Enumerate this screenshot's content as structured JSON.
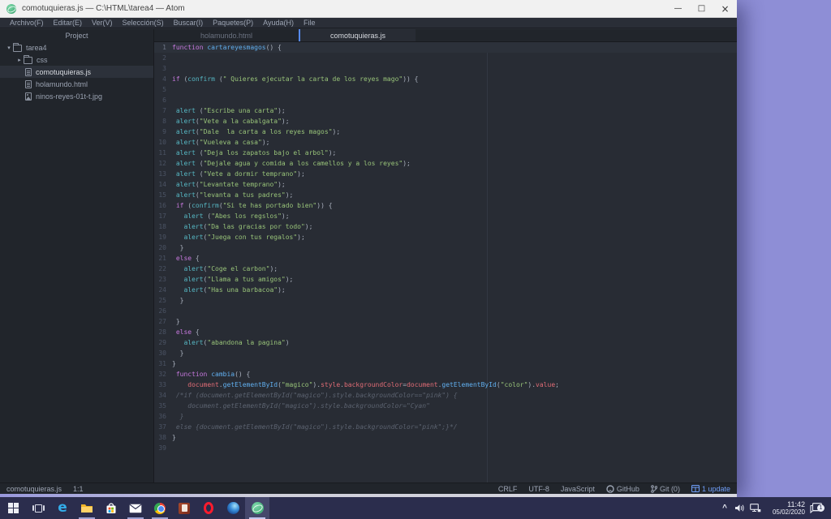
{
  "desktop": {
    "wallpaper_color": "#8e8ed6"
  },
  "window": {
    "title": "comotuquieras.js — C:\\HTML\\tarea4 — Atom",
    "controls": {
      "minimize": "—",
      "maximize": "□",
      "close": "×"
    }
  },
  "menu": {
    "items": [
      "Archivo(F)",
      "Editar(E)",
      "Ver(V)",
      "Selección(S)",
      "Buscar(I)",
      "Paquetes(P)",
      "Ayuda(H)",
      "File"
    ]
  },
  "project": {
    "header": "Project",
    "tree": [
      {
        "label": "tarea4",
        "type": "folder",
        "expanded": true,
        "depth": 0,
        "selected": false
      },
      {
        "label": "css",
        "type": "folder",
        "expanded": false,
        "depth": 1,
        "selected": false
      },
      {
        "label": "comotuquieras.js",
        "type": "file",
        "depth": 1,
        "selected": true
      },
      {
        "label": "holamundo.html",
        "type": "file",
        "depth": 1,
        "selected": false
      },
      {
        "label": "ninos-reyes-01t-t.jpg",
        "type": "image",
        "depth": 1,
        "selected": false
      }
    ]
  },
  "tabs": [
    {
      "label": "holamundo.html",
      "active": false
    },
    {
      "label": "comotuquieras.js",
      "active": true
    }
  ],
  "editor": {
    "active_line": 1,
    "lines": [
      [
        [
          "kw",
          "function"
        ],
        [
          "pl",
          " "
        ],
        [
          "fn",
          "cartareyesmagos"
        ],
        [
          "pl",
          "() {"
        ]
      ],
      [],
      [],
      [
        [
          "kw",
          "if"
        ],
        [
          "pl",
          " ("
        ],
        [
          "sup",
          "confirm"
        ],
        [
          "pl",
          " ("
        ],
        [
          "str",
          "\" Quieres ejecutar la carta de los reyes mago\""
        ],
        [
          "pl",
          ")) {"
        ]
      ],
      [],
      [],
      [
        [
          "pl",
          " "
        ],
        [
          "sup",
          "alert"
        ],
        [
          "pl",
          " ("
        ],
        [
          "str",
          "\"Escribe una carta\""
        ],
        [
          "pl",
          ");"
        ]
      ],
      [
        [
          "pl",
          " "
        ],
        [
          "sup",
          "alert"
        ],
        [
          "pl",
          "("
        ],
        [
          "str",
          "\"Vete a la cabalgata\""
        ],
        [
          "pl",
          ");"
        ]
      ],
      [
        [
          "pl",
          " "
        ],
        [
          "sup",
          "alert"
        ],
        [
          "pl",
          "("
        ],
        [
          "str",
          "\"Dale  la carta a los reyes magos\""
        ],
        [
          "pl",
          ");"
        ]
      ],
      [
        [
          "pl",
          " "
        ],
        [
          "sup",
          "alert"
        ],
        [
          "pl",
          "("
        ],
        [
          "str",
          "\"Vueleva a casa\""
        ],
        [
          "pl",
          ");"
        ]
      ],
      [
        [
          "pl",
          " "
        ],
        [
          "sup",
          "alert"
        ],
        [
          "pl",
          " ("
        ],
        [
          "str",
          "\"Deja los zapatos bajo el arbol\""
        ],
        [
          "pl",
          ");"
        ]
      ],
      [
        [
          "pl",
          " "
        ],
        [
          "sup",
          "alert"
        ],
        [
          "pl",
          " ("
        ],
        [
          "str",
          "\"Dejale agua y comida a los camellos y a los reyes\""
        ],
        [
          "pl",
          ");"
        ]
      ],
      [
        [
          "pl",
          " "
        ],
        [
          "sup",
          "alert"
        ],
        [
          "pl",
          " ("
        ],
        [
          "str",
          "\"Vete a dormir temprano\""
        ],
        [
          "pl",
          ");"
        ]
      ],
      [
        [
          "pl",
          " "
        ],
        [
          "sup",
          "alert"
        ],
        [
          "pl",
          "("
        ],
        [
          "str",
          "\"Levantate temprano\""
        ],
        [
          "pl",
          ");"
        ]
      ],
      [
        [
          "pl",
          " "
        ],
        [
          "sup",
          "alert"
        ],
        [
          "pl",
          "("
        ],
        [
          "str",
          "\"levanta a tus padres\""
        ],
        [
          "pl",
          ");"
        ]
      ],
      [
        [
          "pl",
          " "
        ],
        [
          "kw",
          "if"
        ],
        [
          "pl",
          " ("
        ],
        [
          "sup",
          "confirm"
        ],
        [
          "pl",
          "("
        ],
        [
          "str",
          "\"Si te has portado bien\""
        ],
        [
          "pl",
          ")) {"
        ]
      ],
      [
        [
          "pl",
          "   "
        ],
        [
          "sup",
          "alert"
        ],
        [
          "pl",
          " ("
        ],
        [
          "str",
          "\"Abes los regslos\""
        ],
        [
          "pl",
          ");"
        ]
      ],
      [
        [
          "pl",
          "   "
        ],
        [
          "sup",
          "alert"
        ],
        [
          "pl",
          "("
        ],
        [
          "str",
          "\"Da las gracias por todo\""
        ],
        [
          "pl",
          ");"
        ]
      ],
      [
        [
          "pl",
          "   "
        ],
        [
          "sup",
          "alert"
        ],
        [
          "pl",
          "("
        ],
        [
          "str",
          "\"Juega con tus regalos\""
        ],
        [
          "pl",
          ");"
        ]
      ],
      [
        [
          "pl",
          "  }"
        ]
      ],
      [
        [
          "pl",
          " "
        ],
        [
          "kw",
          "else"
        ],
        [
          "pl",
          " {"
        ]
      ],
      [
        [
          "pl",
          "   "
        ],
        [
          "sup",
          "alert"
        ],
        [
          "pl",
          "("
        ],
        [
          "str",
          "\"Coge el carbon\""
        ],
        [
          "pl",
          ");"
        ]
      ],
      [
        [
          "pl",
          "   "
        ],
        [
          "sup",
          "alert"
        ],
        [
          "pl",
          "("
        ],
        [
          "str",
          "\"Llama a tus amigos\""
        ],
        [
          "pl",
          ");"
        ]
      ],
      [
        [
          "pl",
          "   "
        ],
        [
          "sup",
          "alert"
        ],
        [
          "pl",
          "("
        ],
        [
          "str",
          "\"Has una barbacoa\""
        ],
        [
          "pl",
          ");"
        ]
      ],
      [
        [
          "pl",
          "  }"
        ]
      ],
      [],
      [
        [
          "pl",
          " }"
        ]
      ],
      [
        [
          "pl",
          " "
        ],
        [
          "kw",
          "else"
        ],
        [
          "pl",
          " {"
        ]
      ],
      [
        [
          "pl",
          "   "
        ],
        [
          "sup",
          "alert"
        ],
        [
          "pl",
          "("
        ],
        [
          "str",
          "\"abandona la pagina\""
        ],
        [
          "pl",
          ")"
        ]
      ],
      [
        [
          "pl",
          "  }"
        ]
      ],
      [
        [
          "pl",
          "}"
        ]
      ],
      [
        [
          "pl",
          " "
        ],
        [
          "kw",
          "function"
        ],
        [
          "pl",
          " "
        ],
        [
          "fn",
          "cambia"
        ],
        [
          "pl",
          "() {"
        ]
      ],
      [
        [
          "pl",
          "    "
        ],
        [
          "prop",
          "document"
        ],
        [
          "pl",
          "."
        ],
        [
          "fn",
          "getElementById"
        ],
        [
          "pl",
          "("
        ],
        [
          "str",
          "\"magico\""
        ],
        [
          "pl",
          ")."
        ],
        [
          "prop",
          "style"
        ],
        [
          "pl",
          "."
        ],
        [
          "prop",
          "backgroundColor"
        ],
        [
          "pl",
          "="
        ],
        [
          "prop",
          "document"
        ],
        [
          "pl",
          "."
        ],
        [
          "fn",
          "getElementById"
        ],
        [
          "pl",
          "("
        ],
        [
          "str",
          "\"color\""
        ],
        [
          "pl",
          ")."
        ],
        [
          "prop",
          "value"
        ],
        [
          "pl",
          ";"
        ]
      ],
      [
        [
          "pl",
          " "
        ],
        [
          "cmt",
          "/*if (document.getElementById(\"magico\").style.backgroundColor==\"pink\") {"
        ]
      ],
      [
        [
          "cmt",
          "    document.getElementById(\"magico\").style.backgroundColor=\"Cyan\""
        ]
      ],
      [
        [
          "cmt",
          "  }"
        ]
      ],
      [
        [
          "pl",
          " "
        ],
        [
          "cmt",
          "else {document.getElementById(\"magico\").style.backgroundColor=\"pink\";}*/"
        ]
      ],
      [
        [
          "pl",
          "}"
        ]
      ],
      []
    ]
  },
  "status": {
    "file": "comotuquieras.js",
    "position": "1:1",
    "line_ending": "CRLF",
    "encoding": "UTF-8",
    "grammar": "JavaScript",
    "github": "GitHub",
    "git": "Git (0)",
    "updates": "1 update"
  },
  "taskbar": {
    "apps": [
      "start",
      "task-view",
      "edge",
      "file-explorer",
      "store",
      "mail",
      "chrome",
      "red-document-app",
      "opera",
      "blue-sphere-app",
      "atom"
    ],
    "open_apps": [
      "file-explorer",
      "mail",
      "chrome",
      "atom"
    ],
    "active_app": "atom",
    "tray": {
      "chevron": "^",
      "time": "11:42",
      "date": "05/02/2020",
      "badge": "1"
    }
  },
  "colors": {
    "accent_blue": "#568af2",
    "keyword_purple": "#c678dd",
    "function_blue": "#61afef",
    "support_cyan": "#56b6c2",
    "string_green": "#98c379",
    "property_red": "#e06c75",
    "comment_gray": "#5c6370",
    "update_blue": "#6f9ef8",
    "editor_bg": "#282c34",
    "panel_bg": "#21252b"
  }
}
